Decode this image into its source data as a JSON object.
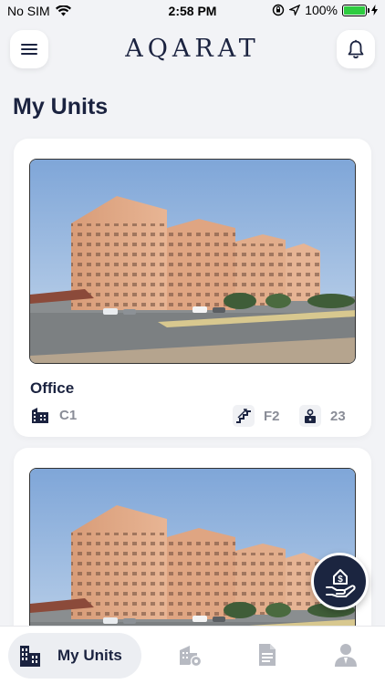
{
  "status_bar": {
    "carrier": "No SIM",
    "time": "2:58 PM",
    "battery": "100%",
    "battery_level": 1.0
  },
  "header": {
    "logo": "AQARAT",
    "menu_icon": "hamburger-menu-icon",
    "notification_icon": "bell-icon"
  },
  "page": {
    "title": "My Units"
  },
  "units": [
    {
      "type": "Office",
      "building": "C1",
      "floor": "F2",
      "unit_number": "23"
    },
    {
      "type": "",
      "building": "",
      "floor": "",
      "unit_number": ""
    }
  ],
  "fab": {
    "icon": "hand-dollar-payment-icon"
  },
  "tabbar": {
    "active_label": "My Units",
    "tabs": [
      {
        "icon": "building-icon",
        "label": "My Units"
      },
      {
        "icon": "building-settings-icon",
        "label": ""
      },
      {
        "icon": "document-icon",
        "label": ""
      },
      {
        "icon": "user-icon",
        "label": ""
      }
    ]
  },
  "colors": {
    "brand": "#1b2340",
    "background": "#f2f3f6",
    "battery_green": "#2ecc40"
  }
}
